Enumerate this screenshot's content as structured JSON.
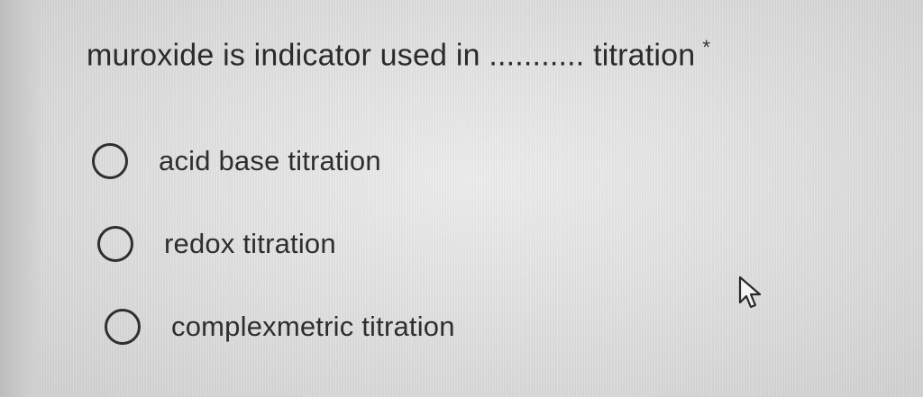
{
  "question": {
    "text": "muroxide is indicator used in ........... titration",
    "required_marker": "*"
  },
  "options": [
    {
      "label": "acid base titration",
      "selected": false
    },
    {
      "label": "redox titration",
      "selected": false
    },
    {
      "label": "complexmetric titration",
      "selected": false
    }
  ],
  "cursor": {
    "icon": "arrow-cursor-icon"
  }
}
